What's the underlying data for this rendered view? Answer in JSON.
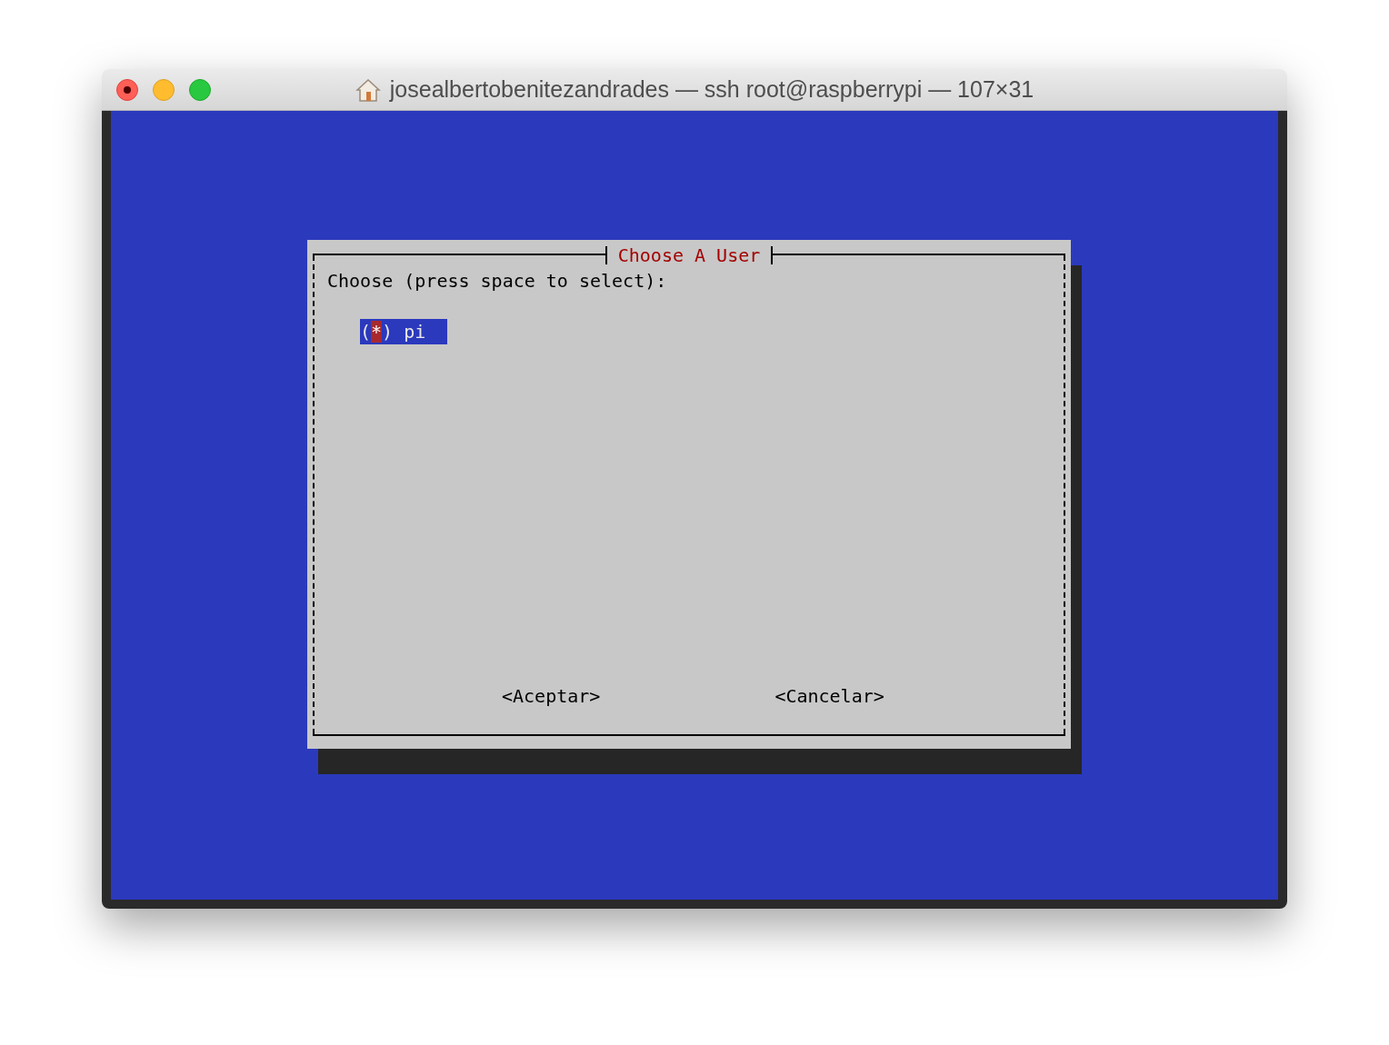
{
  "window": {
    "title": "josealbertobenitezandrades — ssh root@raspberrypi — 107×31"
  },
  "dialog": {
    "title": "Choose A User",
    "prompt": "Choose (press space to select):",
    "items": [
      {
        "label": "pi",
        "open": "(",
        "mark": "*",
        "close": ")",
        "checked": true,
        "selected": true
      }
    ],
    "buttons": [
      {
        "label": "<Aceptar>"
      },
      {
        "label": "<Cancelar>"
      }
    ]
  }
}
